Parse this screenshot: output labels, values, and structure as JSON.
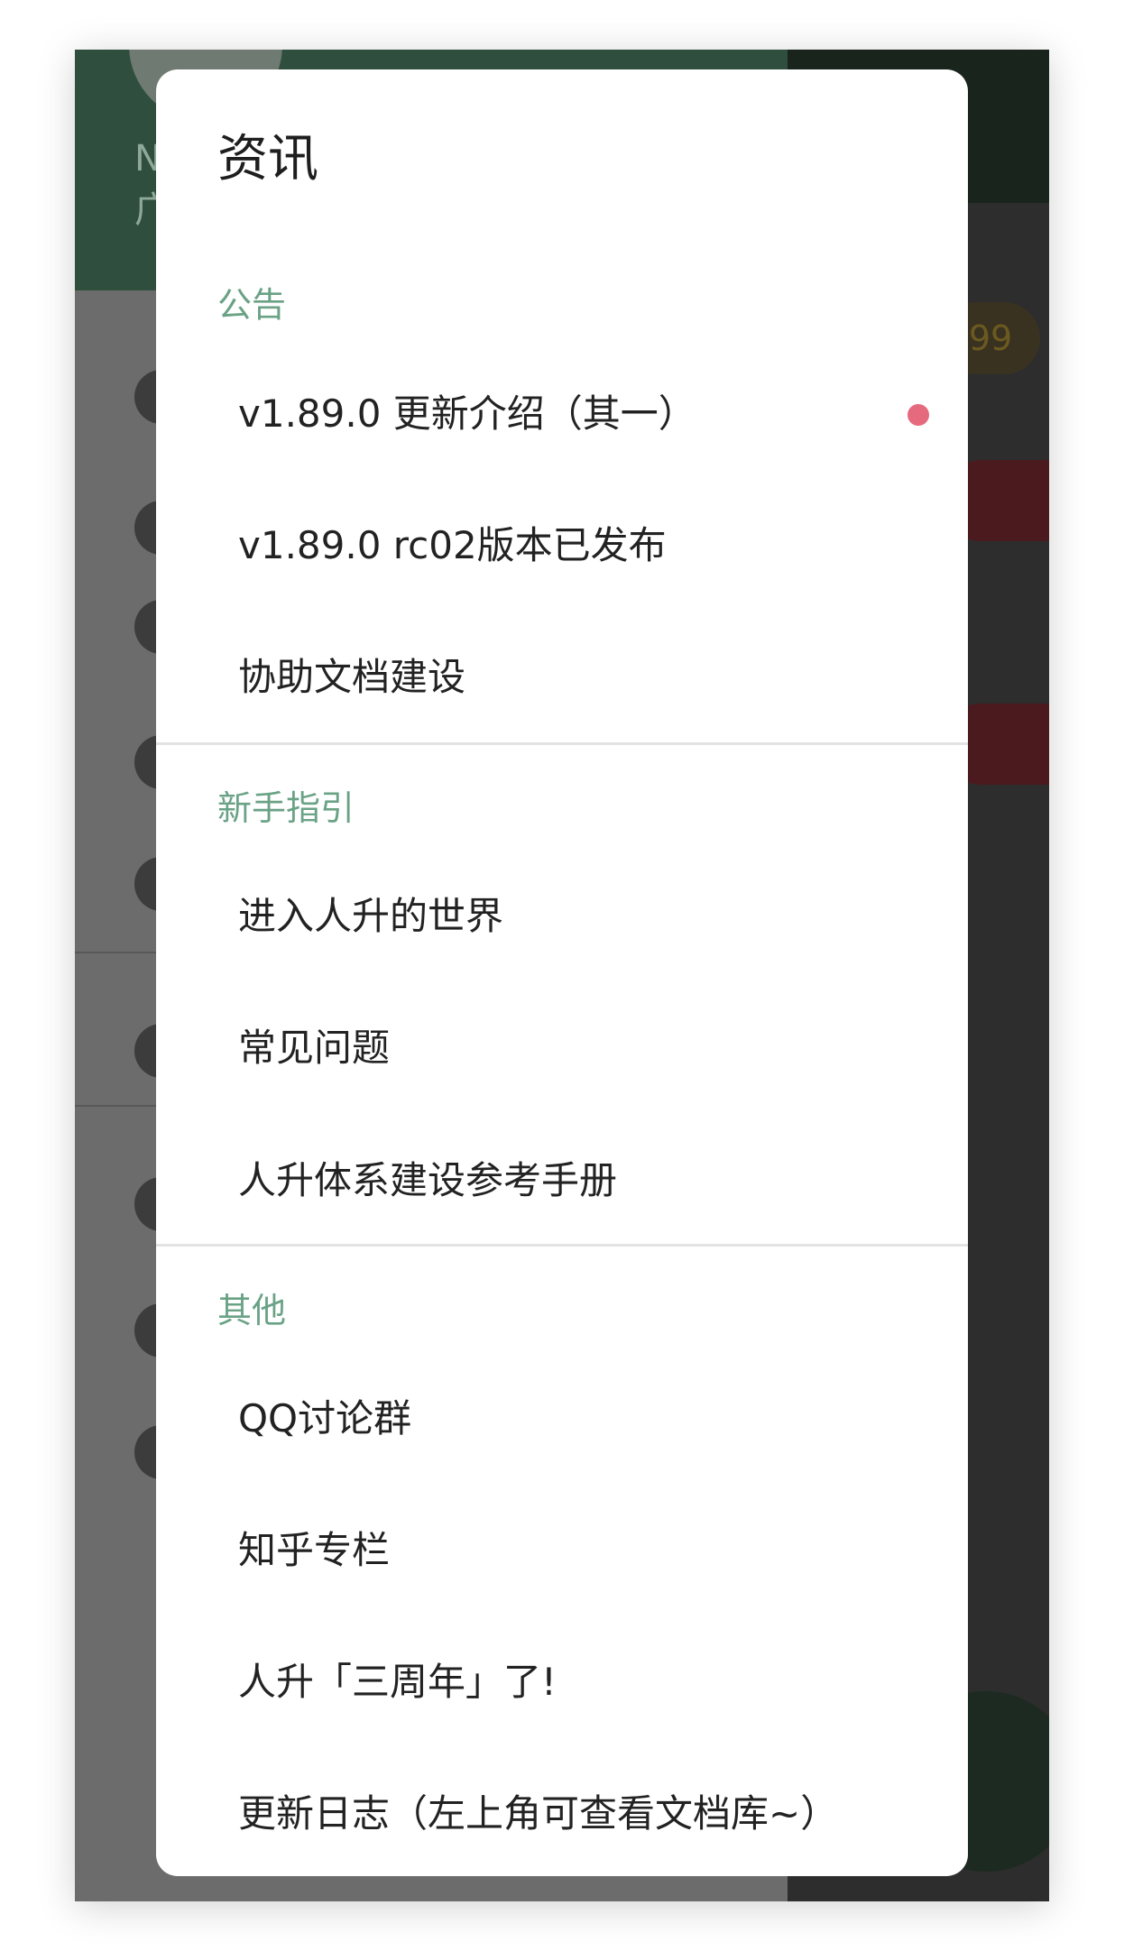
{
  "dialog": {
    "title": "资讯",
    "sections": [
      {
        "header": "公告",
        "items": [
          {
            "label": "v1.89.0 更新介绍（其一）",
            "unread": true
          },
          {
            "label": "v1.89.0 rc02版本已发布",
            "unread": false
          },
          {
            "label": "协助文档建设",
            "unread": false
          }
        ]
      },
      {
        "header": "新手指引",
        "items": [
          {
            "label": "进入人升的世界"
          },
          {
            "label": "常见问题"
          },
          {
            "label": "人升体系建设参考手册"
          }
        ]
      },
      {
        "header": "其他",
        "items": [
          {
            "label": "QQ讨论群"
          },
          {
            "label": "知乎专栏"
          },
          {
            "label": "人升「三周年」了!"
          },
          {
            "label": "更新日志（左上角可查看文档库~）"
          }
        ]
      }
    ]
  },
  "background": {
    "header_hint_1": "N",
    "header_hint_2": "广",
    "badge_text": "99"
  },
  "colors": {
    "section_header": "#6aa286",
    "unread_dot": "#e66a7e",
    "scrim": "#6c6c6c",
    "header_green": "#2f4e3d"
  }
}
